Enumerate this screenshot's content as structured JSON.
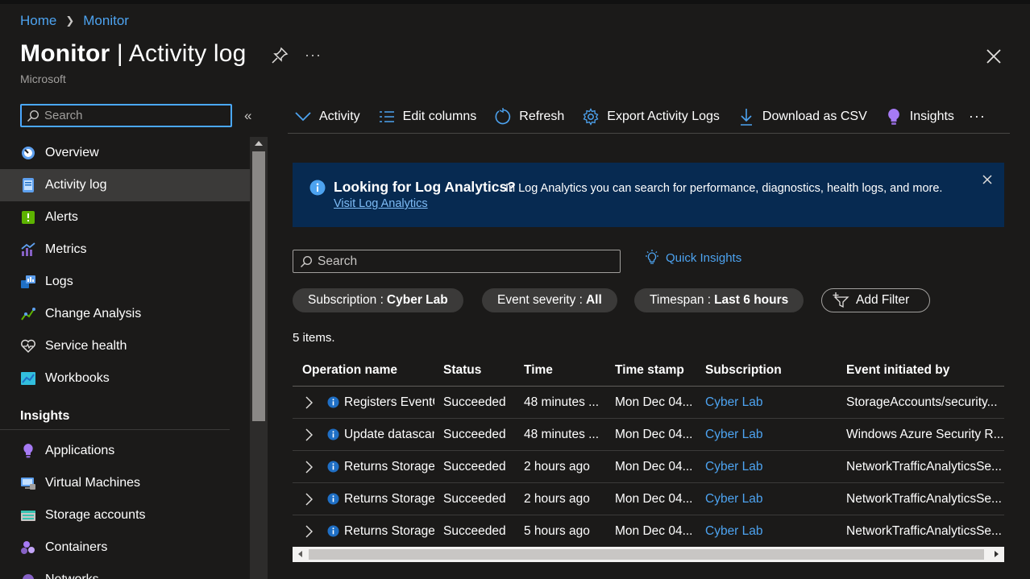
{
  "breadcrumb": {
    "home": "Home",
    "monitor": "Monitor"
  },
  "header": {
    "title_bold": "Monitor",
    "title_rest": " | Activity log",
    "more": "···",
    "subtitle": "Microsoft"
  },
  "sidebar": {
    "search_placeholder": "Search",
    "collapse": "«",
    "items": [
      {
        "label": "Overview",
        "icon": "overview-icon"
      },
      {
        "label": "Activity log",
        "icon": "activity-log-icon",
        "active": true
      },
      {
        "label": "Alerts",
        "icon": "alerts-icon"
      },
      {
        "label": "Metrics",
        "icon": "metrics-icon"
      },
      {
        "label": "Logs",
        "icon": "logs-icon"
      },
      {
        "label": "Change Analysis",
        "icon": "change-analysis-icon"
      },
      {
        "label": "Service health",
        "icon": "service-health-icon"
      },
      {
        "label": "Workbooks",
        "icon": "workbooks-icon"
      }
    ],
    "insights_heading": "Insights",
    "insights_items": [
      {
        "label": "Applications",
        "icon": "applications-icon"
      },
      {
        "label": "Virtual Machines",
        "icon": "virtual-machines-icon"
      },
      {
        "label": "Storage accounts",
        "icon": "storage-accounts-icon"
      },
      {
        "label": "Containers",
        "icon": "containers-icon"
      },
      {
        "label": "Networks",
        "icon": "networks-icon"
      }
    ]
  },
  "toolbar": {
    "activity": "Activity",
    "edit_columns": "Edit columns",
    "refresh": "Refresh",
    "export": "Export Activity Logs",
    "download": "Download as CSV",
    "insights": "Insights",
    "more": "···"
  },
  "banner": {
    "title": "Looking for Log Analytics?",
    "text": "In Log Analytics you can search for performance, diagnostics, health logs, and more.",
    "link": "Visit Log Analytics"
  },
  "search": {
    "placeholder": "Search"
  },
  "quick_insights": "Quick Insights",
  "filters": {
    "subscription_label": "Subscription :",
    "subscription_value": "Cyber Lab",
    "severity_label": "Event severity :",
    "severity_value": "All",
    "timespan_label": "Timespan :",
    "timespan_value": "Last 6 hours",
    "add_filter": "Add Filter"
  },
  "items_count": "5 items.",
  "table": {
    "headers": {
      "operation": "Operation name",
      "status": "Status",
      "time": "Time",
      "timestamp": "Time stamp",
      "subscription": "Subscription",
      "initiated_by": "Event initiated by"
    },
    "rows": [
      {
        "operation": "Registers EventGrid",
        "status": "Succeeded",
        "time": "48 minutes ...",
        "timestamp": "Mon Dec 04...",
        "subscription": "Cyber Lab",
        "initiated_by": "StorageAccounts/security..."
      },
      {
        "operation": "Update datascanners",
        "status": "Succeeded",
        "time": "48 minutes ...",
        "timestamp": "Mon Dec 04...",
        "subscription": "Cyber Lab",
        "initiated_by": "Windows Azure Security R..."
      },
      {
        "operation": "Returns Storage",
        "status": "Succeeded",
        "time": "2 hours ago",
        "timestamp": "Mon Dec 04...",
        "subscription": "Cyber Lab",
        "initiated_by": "NetworkTrafficAnalyticsSe..."
      },
      {
        "operation": "Returns Storage",
        "status": "Succeeded",
        "time": "2 hours ago",
        "timestamp": "Mon Dec 04...",
        "subscription": "Cyber Lab",
        "initiated_by": "NetworkTrafficAnalyticsSe..."
      },
      {
        "operation": "Returns Storage",
        "status": "Succeeded",
        "time": "5 hours ago",
        "timestamp": "Mon Dec 04...",
        "subscription": "Cyber Lab",
        "initiated_by": "NetworkTrafficAnalyticsSe..."
      }
    ]
  }
}
